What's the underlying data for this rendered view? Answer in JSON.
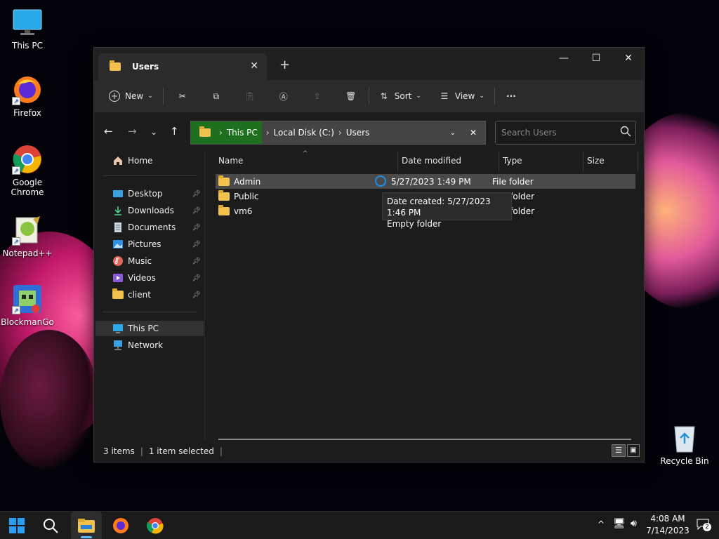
{
  "desktop": {
    "icons": [
      {
        "label": "This PC"
      },
      {
        "label": "Firefox"
      },
      {
        "label": "Google Chrome"
      },
      {
        "label": "Notepad++"
      },
      {
        "label": "BlockmanGo"
      },
      {
        "label": "Recycle Bin"
      }
    ]
  },
  "window": {
    "tab_title": "Users",
    "toolbar": {
      "new_label": "New",
      "sort_label": "Sort",
      "view_label": "View",
      "more_label": "···"
    },
    "address": {
      "crumbs": [
        "This PC",
        "Local Disk (C:)",
        "Users"
      ]
    },
    "search": {
      "placeholder": "Search Users"
    },
    "sidebar": {
      "home": "Home",
      "pinned": [
        "Desktop",
        "Downloads",
        "Documents",
        "Pictures",
        "Music",
        "Videos",
        "client"
      ],
      "this_pc": "This PC",
      "network": "Network"
    },
    "columns": {
      "name": "Name",
      "date": "Date modified",
      "type": "Type",
      "size": "Size"
    },
    "files": [
      {
        "name": "Admin",
        "date": "5/27/2023 1:49 PM",
        "type": "File folder"
      },
      {
        "name": "Public",
        "date": "",
        "type": "e folder"
      },
      {
        "name": "vm6",
        "date": "",
        "type": "e folder"
      }
    ],
    "tooltip": {
      "line1": "Date created: 5/27/2023 1:46 PM",
      "line2": "Empty folder"
    },
    "status": {
      "items": "3 items",
      "selected": "1 item selected"
    }
  },
  "taskbar": {
    "time": "4:08 AM",
    "date": "7/14/2023",
    "notifications": "2"
  },
  "colors": {
    "accent": "#5ab8ff",
    "address_highlight": "#1e6f1e"
  }
}
